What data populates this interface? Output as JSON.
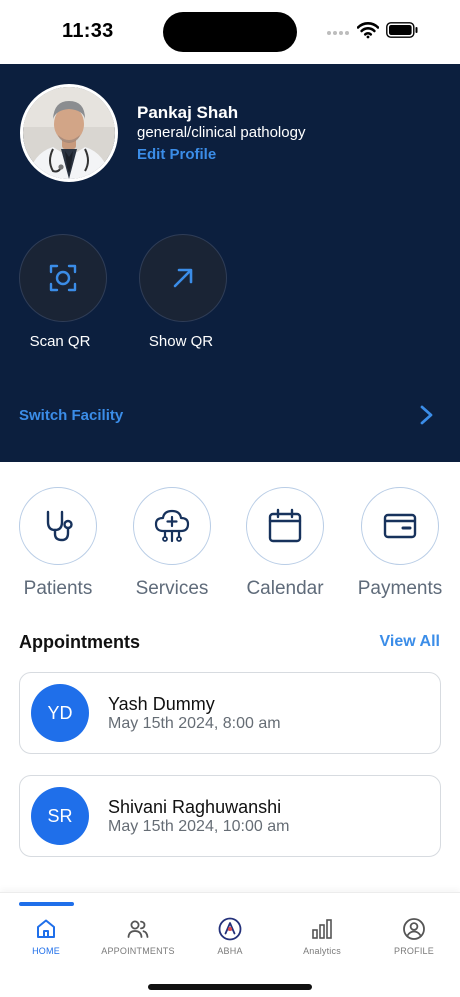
{
  "status_bar": {
    "time": "11:33"
  },
  "profile": {
    "name": "Pankaj Shah",
    "specialty": "general/clinical pathology",
    "edit_label": "Edit Profile"
  },
  "qr_actions": [
    {
      "label": "Scan QR",
      "icon": "scan-qr-icon"
    },
    {
      "label": "Show QR",
      "icon": "arrow-up-right-icon"
    }
  ],
  "switch_facility": {
    "label": "Switch Facility",
    "icon": "chevron-right-icon"
  },
  "quick_actions": [
    {
      "label": "Patients",
      "icon": "stethoscope-icon"
    },
    {
      "label": "Services",
      "icon": "services-icon"
    },
    {
      "label": "Calendar",
      "icon": "calendar-icon"
    },
    {
      "label": "Payments",
      "icon": "wallet-icon"
    }
  ],
  "appointments": {
    "title": "Appointments",
    "view_all": "View All",
    "items": [
      {
        "initials": "YD",
        "name": "Yash Dummy",
        "time": "May 15th 2024, 8:00 am"
      },
      {
        "initials": "SR",
        "name": "Shivani Raghuwanshi",
        "time": "May 15th 2024, 10:00 am"
      }
    ]
  },
  "bottom_nav": {
    "active": "HOME",
    "items": [
      {
        "label": "HOME",
        "icon": "home-icon"
      },
      {
        "label": "APPOINTMENTS",
        "icon": "users-icon"
      },
      {
        "label": "ABHA",
        "icon": "abha-logo-icon"
      },
      {
        "label": "Analytics",
        "icon": "bar-chart-icon"
      },
      {
        "label": "PROFILE",
        "icon": "user-circle-icon"
      }
    ]
  },
  "colors": {
    "hero_bg": "#0c1f3e",
    "accent": "#3b8de8",
    "primary": "#1f6fea",
    "icon_navy": "#17325c"
  }
}
